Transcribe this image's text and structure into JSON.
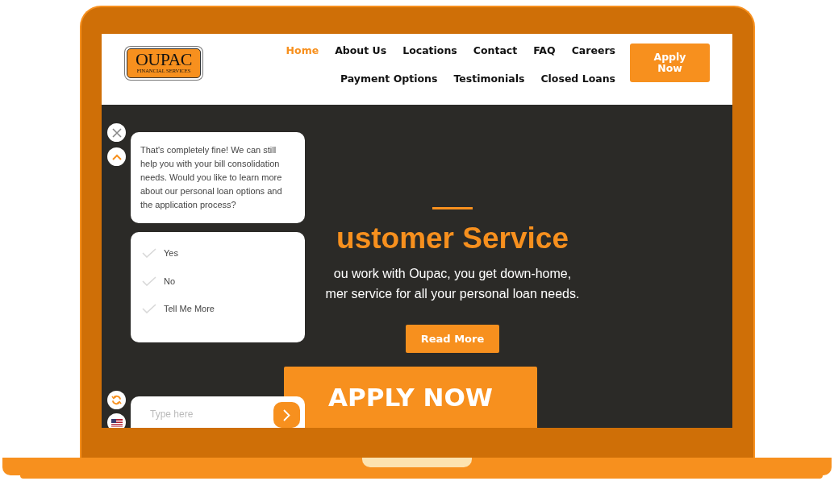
{
  "logo": {
    "title": "OUPAC",
    "subtitle": "FINANCIAL SERVICES"
  },
  "nav": {
    "items": [
      {
        "label": "Home",
        "selected": true
      },
      {
        "label": "About Us",
        "selected": false
      },
      {
        "label": "Locations",
        "selected": false
      },
      {
        "label": "Contact",
        "selected": false
      },
      {
        "label": "FAQ",
        "selected": false
      },
      {
        "label": "Careers",
        "selected": false
      },
      {
        "label": "Payment Options",
        "selected": false
      },
      {
        "label": "Testimonials",
        "selected": false
      },
      {
        "label": "Closed Loans",
        "selected": false
      }
    ]
  },
  "apply_button": "Apply Now",
  "hero": {
    "heading": "ustomer Service",
    "lines": [
      "ou work with Oupac, you get down-home,",
      "mer service for all your personal loan needs."
    ],
    "read_more": "Read More",
    "apply_now": "APPLY NOW"
  },
  "chat": {
    "message": "That's completely fine! We can still help you with your bill consolidation needs. Would you like to learn more about our personal loan options and the application process?",
    "options": [
      {
        "label": "Yes"
      },
      {
        "label": "No"
      },
      {
        "label": "Tell Me More"
      }
    ],
    "input": {
      "placeholder": "Type here"
    }
  }
}
